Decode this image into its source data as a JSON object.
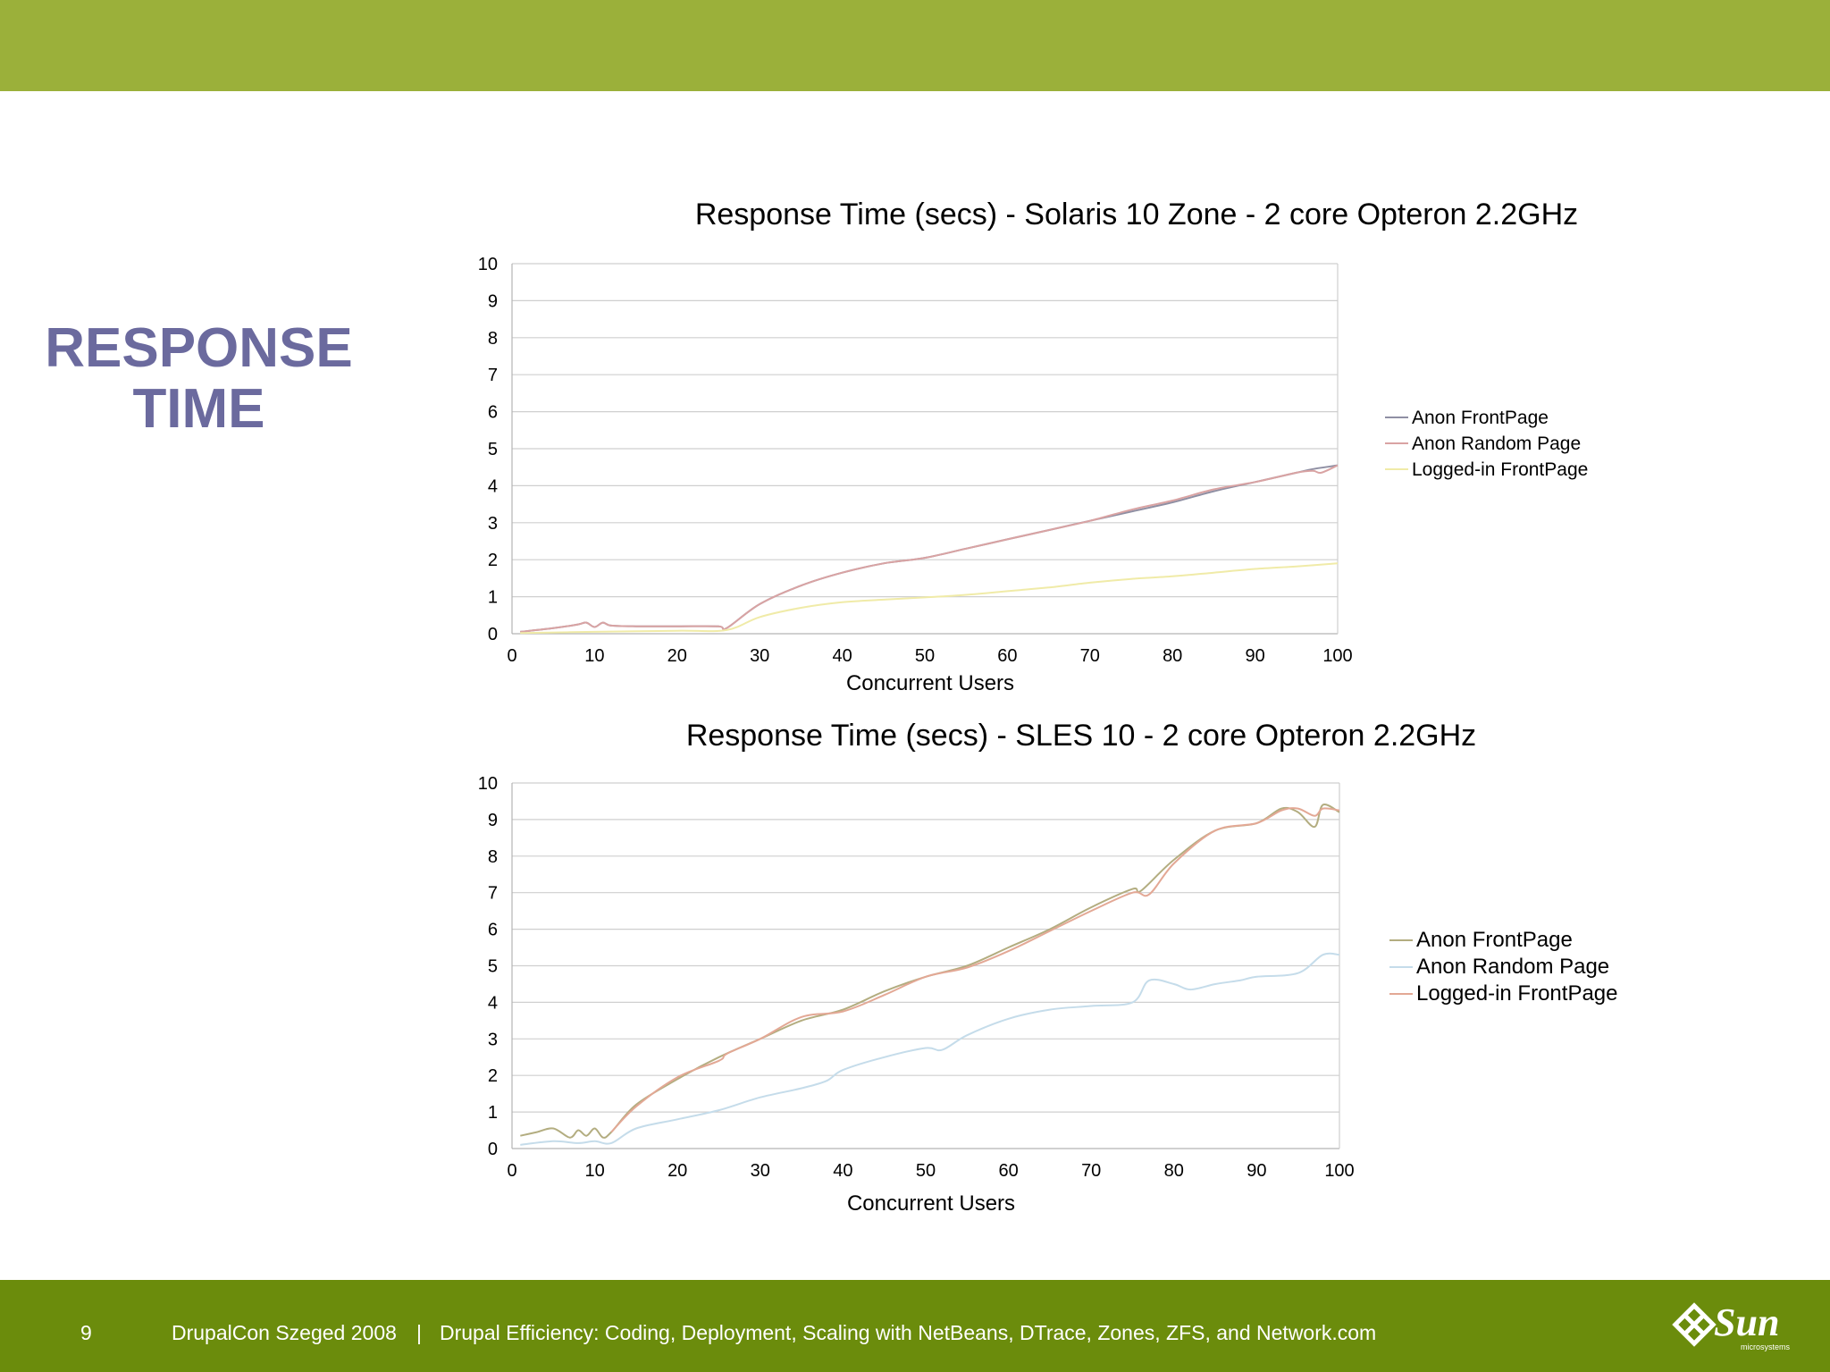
{
  "slide": {
    "heading": "RESPONSE TIME",
    "page_number": "9",
    "footer_event": "DrupalCon Szeged 2008",
    "footer_separator": "|",
    "footer_talk": "Drupal Efficiency: Coding, Deployment, Scaling with NetBeans, DTrace, Zones, ZFS, and Network.com",
    "logo_text": "Sun",
    "logo_subtext": "microsystems",
    "colors": {
      "top_bar": "#9bb03a",
      "footer_bar": "#6b8c0c",
      "heading": "#6b6a9e"
    }
  },
  "chart_data": [
    {
      "type": "line",
      "title": "Response Time (secs) - Solaris 10 Zone - 2 core Opteron 2.2GHz",
      "xlabel": "Concurrent Users",
      "ylabel": "",
      "xlim": [
        0,
        100
      ],
      "ylim": [
        0,
        10
      ],
      "xticks": [
        0,
        10,
        20,
        30,
        40,
        50,
        60,
        70,
        80,
        90,
        100
      ],
      "yticks": [
        0,
        1,
        2,
        3,
        4,
        5,
        6,
        7,
        8,
        9,
        10
      ],
      "grid": true,
      "legend_position": "right",
      "series": [
        {
          "name": "Anon FrontPage",
          "color": "#8f8fa3",
          "x": [
            1,
            5,
            8,
            9,
            10,
            11,
            12,
            15,
            20,
            25,
            26,
            30,
            35,
            40,
            45,
            50,
            55,
            60,
            65,
            70,
            75,
            80,
            85,
            90,
            95,
            97,
            100
          ],
          "y": [
            0.05,
            0.15,
            0.25,
            0.3,
            0.18,
            0.3,
            0.22,
            0.2,
            0.2,
            0.2,
            0.15,
            0.8,
            1.3,
            1.65,
            1.9,
            2.05,
            2.3,
            2.55,
            2.8,
            3.05,
            3.3,
            3.55,
            3.85,
            4.1,
            4.35,
            4.45,
            4.55
          ]
        },
        {
          "name": "Anon Random Page",
          "color": "#d9a3a3",
          "x": [
            1,
            5,
            8,
            9,
            10,
            11,
            12,
            15,
            20,
            25,
            26,
            30,
            35,
            40,
            45,
            50,
            55,
            60,
            65,
            70,
            75,
            80,
            85,
            90,
            95,
            97,
            98,
            100
          ],
          "y": [
            0.05,
            0.15,
            0.25,
            0.3,
            0.18,
            0.3,
            0.22,
            0.2,
            0.2,
            0.2,
            0.15,
            0.8,
            1.3,
            1.65,
            1.9,
            2.05,
            2.3,
            2.55,
            2.8,
            3.05,
            3.35,
            3.6,
            3.9,
            4.1,
            4.35,
            4.4,
            4.35,
            4.55
          ]
        },
        {
          "name": "Logged-in FrontPage",
          "color": "#f0eba8",
          "x": [
            1,
            10,
            20,
            26,
            30,
            35,
            40,
            45,
            50,
            55,
            60,
            65,
            70,
            75,
            80,
            85,
            90,
            95,
            100
          ],
          "y": [
            0.02,
            0.05,
            0.08,
            0.1,
            0.45,
            0.7,
            0.85,
            0.92,
            0.98,
            1.05,
            1.15,
            1.25,
            1.38,
            1.48,
            1.55,
            1.65,
            1.75,
            1.82,
            1.9
          ]
        }
      ]
    },
    {
      "type": "line",
      "title": "Response Time (secs) - SLES 10 - 2 core Opteron 2.2GHz",
      "xlabel": "Concurrent Users",
      "ylabel": "",
      "xlim": [
        0,
        100
      ],
      "ylim": [
        0,
        10
      ],
      "xticks": [
        0,
        10,
        20,
        30,
        40,
        50,
        60,
        70,
        80,
        90,
        100
      ],
      "yticks": [
        0,
        1,
        2,
        3,
        4,
        5,
        6,
        7,
        8,
        9,
        10
      ],
      "grid": true,
      "legend_position": "right",
      "series": [
        {
          "name": "Anon FrontPage",
          "color": "#b3ad80",
          "x": [
            1,
            3,
            5,
            7,
            8,
            9,
            10,
            11,
            12,
            15,
            20,
            25,
            30,
            35,
            40,
            45,
            50,
            55,
            60,
            65,
            70,
            75,
            76,
            80,
            85,
            90,
            93,
            95,
            97,
            98,
            100
          ],
          "y": [
            0.35,
            0.45,
            0.55,
            0.3,
            0.5,
            0.35,
            0.55,
            0.3,
            0.45,
            1.2,
            1.9,
            2.5,
            3.0,
            3.5,
            3.8,
            4.3,
            4.7,
            5.0,
            5.5,
            6.0,
            6.6,
            7.1,
            7.05,
            7.9,
            8.7,
            8.9,
            9.3,
            9.2,
            8.8,
            9.4,
            9.2
          ]
        },
        {
          "name": "Anon Random Page",
          "color": "#c5dcea",
          "x": [
            1,
            5,
            8,
            10,
            12,
            15,
            20,
            25,
            30,
            35,
            38,
            40,
            45,
            50,
            52,
            55,
            60,
            65,
            70,
            75,
            77,
            80,
            82,
            85,
            88,
            90,
            95,
            98,
            100
          ],
          "y": [
            0.1,
            0.2,
            0.15,
            0.2,
            0.15,
            0.55,
            0.8,
            1.05,
            1.4,
            1.65,
            1.85,
            2.15,
            2.5,
            2.75,
            2.7,
            3.1,
            3.55,
            3.8,
            3.9,
            4.0,
            4.6,
            4.5,
            4.35,
            4.5,
            4.6,
            4.7,
            4.8,
            5.3,
            5.3
          ]
        },
        {
          "name": "Logged-in FrontPage",
          "color": "#e3a895",
          "x": [
            12,
            15,
            20,
            25,
            26,
            30,
            35,
            40,
            45,
            50,
            55,
            60,
            65,
            70,
            75,
            77,
            80,
            85,
            90,
            93,
            95,
            97,
            98,
            100
          ],
          "y": [
            0.45,
            1.15,
            1.95,
            2.4,
            2.6,
            3.0,
            3.6,
            3.75,
            4.2,
            4.7,
            4.95,
            5.4,
            5.95,
            6.5,
            7.0,
            6.95,
            7.8,
            8.7,
            8.9,
            9.25,
            9.3,
            9.1,
            9.3,
            9.25
          ]
        }
      ]
    }
  ]
}
